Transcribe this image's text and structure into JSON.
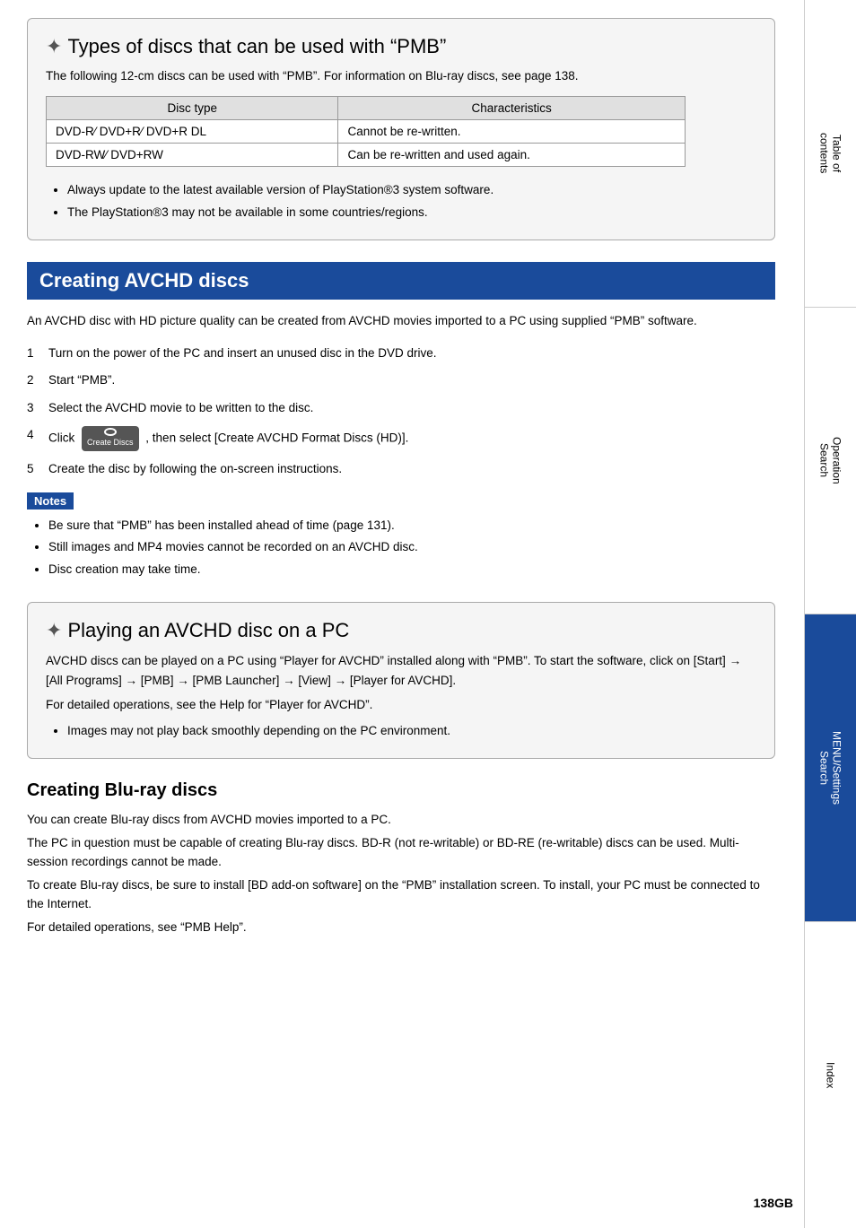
{
  "page": {
    "number": "138GB"
  },
  "sidebar": {
    "tabs": [
      {
        "id": "table-of-contents",
        "label": "Table of\ncontents",
        "active": false
      },
      {
        "id": "operation-search",
        "label": "Operation\nSearch",
        "active": false
      },
      {
        "id": "menu-settings-search",
        "label": "MENU/Settings\nSearch",
        "active": true
      },
      {
        "id": "index",
        "label": "Index",
        "active": false
      }
    ]
  },
  "types_section": {
    "title": "Types of discs that can be used with “PMB”",
    "intro": "The following 12-cm discs can be used with “PMB”. For information on Blu-ray discs, see page 138.",
    "table": {
      "headers": [
        "Disc type",
        "Characteristics"
      ],
      "rows": [
        [
          "DVD-R⁄ DVD+R⁄ DVD+R DL",
          "Cannot be re-written."
        ],
        [
          "DVD-RW⁄ DVD+RW",
          "Can be re-written and used again."
        ]
      ]
    },
    "bullets": [
      "Always update to the latest available version of PlayStation®3 system software.",
      "The PlayStation®3 may not be available in some countries/regions."
    ]
  },
  "avchd_section": {
    "header": "Creating AVCHD discs",
    "intro": "An AVCHD disc with HD picture quality can be created from AVCHD movies imported to a PC using supplied “PMB” software.",
    "steps": [
      "Turn on the power of the PC and insert an unused disc in the DVD drive.",
      "Start “PMB”.",
      "Select the AVCHD movie to be written to the disc.",
      ", then select [Create AVCHD Format Discs (HD)].",
      "Create the disc by following the on-screen instructions."
    ],
    "step_nums": [
      "1",
      "2",
      "3",
      "4",
      "5"
    ],
    "click_label": "Click",
    "btn_label": "Create Discs",
    "notes": {
      "label": "Notes",
      "bullets": [
        "Be sure that “PMB” has been installed ahead of time (page 131).",
        "Still images and MP4 movies cannot be recorded on an AVCHD disc.",
        "Disc creation may take time."
      ]
    }
  },
  "playing_section": {
    "title": "Playing an AVCHD disc on a PC",
    "text1": "AVCHD discs can be played on a PC using “Player for AVCHD” installed along with “PMB”. To start the software, click on [Start] → [All Programs] → [PMB] → [PMB Launcher] → [View] → [Player for AVCHD].",
    "text2": "For detailed operations, see the Help for “Player for AVCHD”.",
    "bullets": [
      "Images may not play back smoothly depending on the PC environment."
    ]
  },
  "bluray_section": {
    "header": "Creating Blu-ray discs",
    "texts": [
      "You can create Blu-ray discs from AVCHD movies imported to a PC.",
      "The PC in question must be capable of creating Blu-ray discs. BD-R (not re-writable) or BD-RE (re-writable) discs can be used. Multi-session recordings cannot be made.",
      "To create Blu-ray discs, be sure to install [BD add-on software] on the “PMB” installation screen. To install, your PC must be connected to the Internet.",
      "For detailed operations, see “PMB Help”."
    ]
  }
}
